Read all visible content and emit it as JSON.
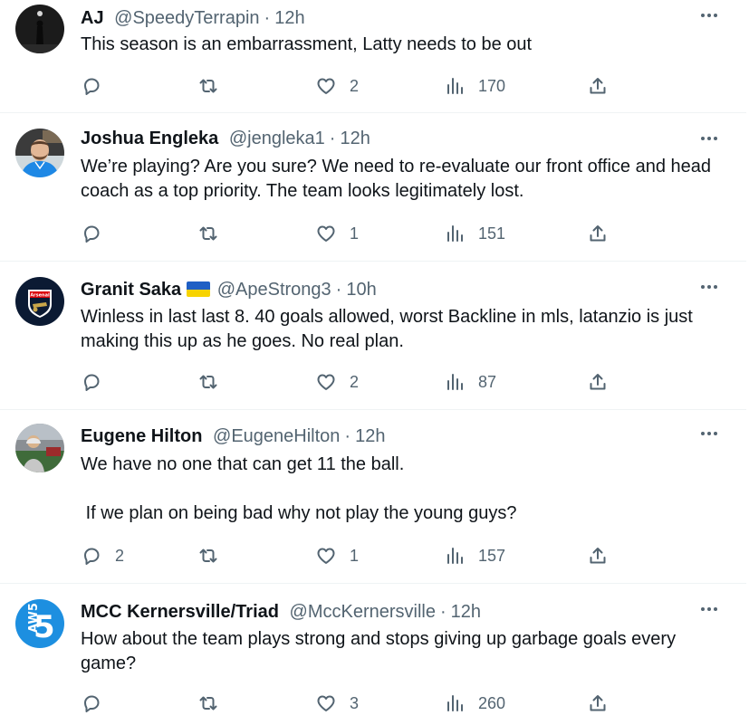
{
  "tweets": [
    {
      "name": "AJ",
      "handle": "@SpeedyTerrapin",
      "time": "12h",
      "text": "This season is an embarrassment, Latty needs to be out",
      "replies": "",
      "retweets": "",
      "likes": "2",
      "views": "170"
    },
    {
      "name": "Joshua Engleka",
      "handle": "@jengleka1",
      "time": "12h",
      "text": "We’re playing? Are you sure? We need to re-evaluate our front office and head coach as a top priority. The team looks legitimately lost.",
      "replies": "",
      "retweets": "",
      "likes": "1",
      "views": "151"
    },
    {
      "name": "Granit Saka",
      "handle": "@ApeStrong3",
      "time": "10h",
      "flag_colors": [
        "#1f5fc4",
        "#f7d300"
      ],
      "text": "Winless in last last 8. 40 goals allowed, worst Backline in mls, latanzio is just making this up as he goes. No real plan.",
      "replies": "",
      "retweets": "",
      "likes": "2",
      "views": "87",
      "avatar_text": "Arsenal"
    },
    {
      "name": "Eugene Hilton",
      "handle": "@EugeneHilton",
      "time": "12h",
      "text": "We have no one that can get 11 the ball.\n\n If we plan on being bad why not play the young guys?",
      "replies": "2",
      "retweets": "",
      "likes": "1",
      "views": "157"
    },
    {
      "name": "MCC Kernersville/Triad",
      "handle": "@MccKernersville",
      "time": "12h",
      "text": "How about the team plays strong and stops giving up garbage goals every game?",
      "replies": "",
      "retweets": "",
      "likes": "3",
      "views": "260",
      "avatar_text": "AW5"
    }
  ],
  "colors": {
    "text_primary": "#0f1419",
    "text_secondary": "#536471",
    "divider": "#eff3f4",
    "aw5_blue": "#1d8fe0"
  },
  "icons": [
    "reply-icon",
    "retweet-icon",
    "like-icon",
    "views-icon",
    "share-icon",
    "more-icon"
  ]
}
